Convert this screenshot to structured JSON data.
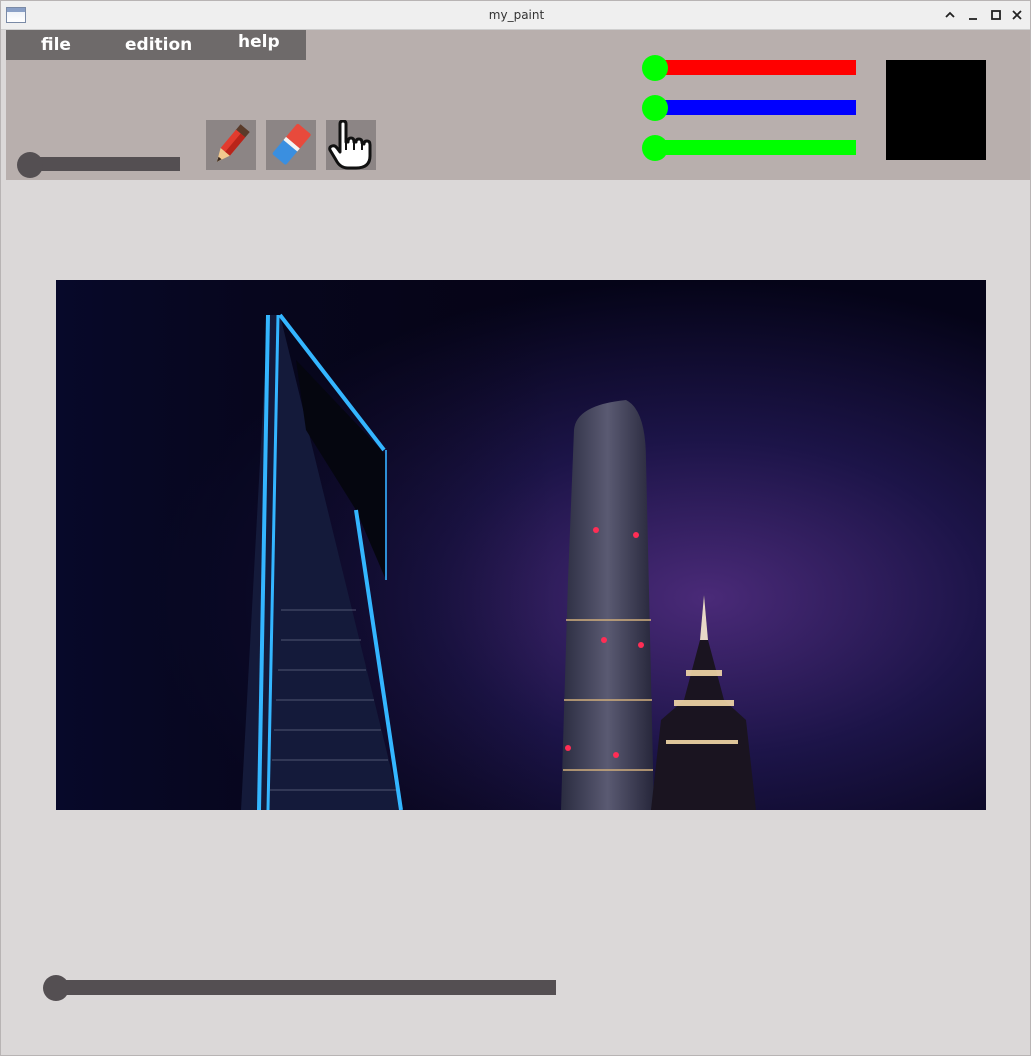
{
  "window": {
    "title": "my_paint"
  },
  "menu": {
    "items": [
      "file",
      "edition",
      "help"
    ]
  },
  "tools": {
    "pencil": "pencil-icon",
    "eraser": "eraser-icon",
    "hand": "hand-icon"
  },
  "color_sliders": [
    {
      "name": "red",
      "color": "#ff0000",
      "value": 0
    },
    {
      "name": "blue",
      "color": "#0000ff",
      "value": 0
    },
    {
      "name": "green",
      "color": "#00ff00",
      "value": 0
    }
  ],
  "brush_size_slider": {
    "value": 0
  },
  "zoom_slider": {
    "value": 0
  },
  "current_color": "#000000",
  "colors": {
    "toolbar_bg": "#b8afad",
    "menu_bg": "#6e6a6a",
    "canvas_bg": "#dbd8d8",
    "knob": "#00ff00",
    "slider_track": "#544f52"
  }
}
